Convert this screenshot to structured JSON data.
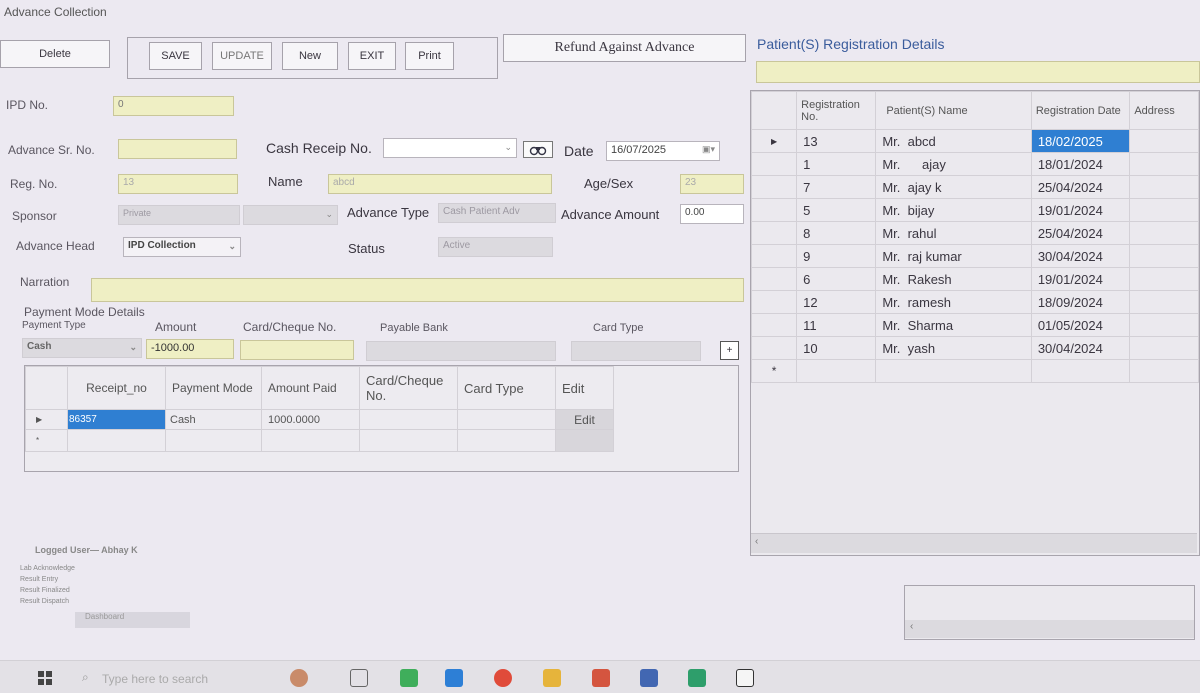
{
  "window": {
    "title": "Advance Collection"
  },
  "toolbar": {
    "delete": "Delete",
    "save": "SAVE",
    "update": "UPDATE",
    "new": "New",
    "exit": "EXIT",
    "print": "Print",
    "refund": "Refund Against Advance"
  },
  "form": {
    "ipd_label": "IPD No.",
    "ipd_value": "0",
    "adv_sr_label": "Advance Sr. No.",
    "adv_sr_value": "",
    "cash_receipt_label": "Cash Receip No.",
    "cash_receipt_value": "",
    "date_label": "Date",
    "date_value": "16/07/2025",
    "reg_label": "Reg. No.",
    "reg_value": "13",
    "name_label": "Name",
    "name_value": "abcd",
    "agesex_label": "Age/Sex",
    "age_value": "23",
    "sponsor_label": "Sponsor",
    "sponsor_value": "Private",
    "advance_type_label": "Advance Type",
    "advance_type_value": "Cash Patient Adv",
    "advance_amount_label": "Advance Amount",
    "advance_amount_value": "0.00",
    "advance_head_label": "Advance Head",
    "advance_head_value": "IPD Collection",
    "status_label": "Status",
    "status_value": "Active",
    "narration_label": "Narration",
    "narration_value": ""
  },
  "payment": {
    "section_title": "Payment Mode Details",
    "type_label": "Payment Type",
    "amount_label": "Amount",
    "card_cheque_label": "Card/Cheque No.",
    "payable_bank_label": "Payable Bank",
    "card_type_label": "Card Type",
    "type_value": "Cash",
    "amount_value": "-1000.00",
    "add_label": "+",
    "grid": {
      "headers": [
        "Receipt_no",
        "Payment Mode",
        "Amount Paid",
        "Card/Cheque No.",
        "Card Type",
        "Edit"
      ],
      "rows": [
        {
          "receipt": "86357",
          "mode": "Cash",
          "amount": "1000.0000",
          "card": "",
          "card_type": "",
          "edit": "Edit"
        }
      ]
    }
  },
  "patients": {
    "title": "Patient(S) Registration Details",
    "headers": {
      "reg": "Registration No.",
      "name": "Patient(S) Name",
      "date": "Registration Date",
      "address": "Address"
    },
    "rows": [
      {
        "reg": "13",
        "name": "Mr.  abcd",
        "date": "18/02/2025"
      },
      {
        "reg": "1",
        "name": "Mr.      ajay",
        "date": "18/01/2024"
      },
      {
        "reg": "7",
        "name": "Mr.  ajay k",
        "date": "25/04/2024"
      },
      {
        "reg": "5",
        "name": "Mr.  bijay",
        "date": "19/01/2024"
      },
      {
        "reg": "8",
        "name": "Mr.  rahul",
        "date": "25/04/2024"
      },
      {
        "reg": "9",
        "name": "Mr.  raj kumar",
        "date": "30/04/2024"
      },
      {
        "reg": "6",
        "name": "Mr.  Rakesh",
        "date": "19/01/2024"
      },
      {
        "reg": "12",
        "name": "Mr.  ramesh",
        "date": "18/09/2024"
      },
      {
        "reg": "11",
        "name": "Mr.  Sharma",
        "date": "01/05/2024"
      },
      {
        "reg": "10",
        "name": "Mr.  yash",
        "date": "30/04/2024"
      }
    ],
    "new_row_marker": "*"
  },
  "footer": {
    "logged_user": "Logged User— Abhay K",
    "menu": [
      "Lab Acknowledge",
      "Result Entry",
      "Result Finalized",
      "Result Dispatch",
      "Dashboard"
    ]
  },
  "taskbar": {
    "search_placeholder": "Type here to search"
  },
  "colors": {
    "selection": "#2f7fd2",
    "yellow_field": "#efefc4",
    "background": "#ece9f1"
  }
}
